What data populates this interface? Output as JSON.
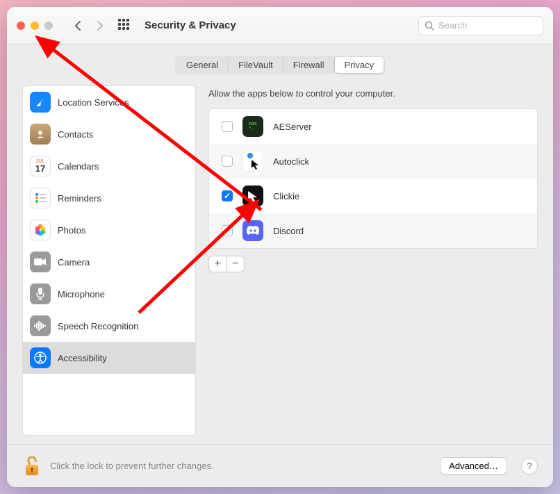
{
  "window": {
    "title": "Security & Privacy"
  },
  "search": {
    "placeholder": "Search"
  },
  "tabs": [
    "General",
    "FileVault",
    "Firewall",
    "Privacy"
  ],
  "active_tab_index": 3,
  "sidebar": {
    "items": [
      {
        "label": "Location Services",
        "icon": "location",
        "bg": "#1787ff"
      },
      {
        "label": "Contacts",
        "icon": "contacts",
        "bg": "linear-gradient(#c29a6b,#9b7449)"
      },
      {
        "label": "Calendars",
        "icon": "calendar",
        "bg": "#ffffff"
      },
      {
        "label": "Reminders",
        "icon": "reminders",
        "bg": "#ffffff"
      },
      {
        "label": "Photos",
        "icon": "photos",
        "bg": "#ffffff"
      },
      {
        "label": "Camera",
        "icon": "camera",
        "bg": "#9a9a9a"
      },
      {
        "label": "Microphone",
        "icon": "microphone",
        "bg": "#9a9a9a"
      },
      {
        "label": "Speech Recognition",
        "icon": "speech",
        "bg": "#9a9a9a"
      },
      {
        "label": "Accessibility",
        "icon": "accessibility",
        "bg": "#0a7aff"
      }
    ],
    "selected_index": 8
  },
  "detail": {
    "heading": "Allow the apps below to control your computer.",
    "apps": [
      {
        "name": "AEServer",
        "checked": false,
        "icon_bg": "#1a2b1a"
      },
      {
        "name": "Autoclick",
        "checked": false,
        "icon_bg": "#ffffff"
      },
      {
        "name": "Clickie",
        "checked": true,
        "icon_bg": "#111111"
      },
      {
        "name": "Discord",
        "checked": false,
        "icon_bg": "#5865f2"
      }
    ]
  },
  "footer": {
    "lock_text": "Click the lock to prevent further changes.",
    "advanced_label": "Advanced…"
  }
}
